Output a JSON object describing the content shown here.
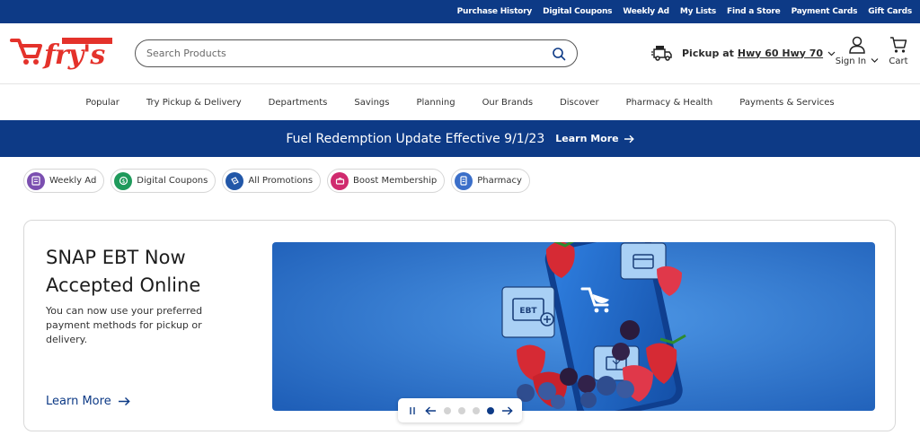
{
  "utility_links": [
    "Purchase History",
    "Digital Coupons",
    "Weekly Ad",
    "My Lists",
    "Find a Store",
    "Payment Cards",
    "Gift Cards"
  ],
  "header": {
    "search_placeholder": "Search Products",
    "pickup_label": "Pickup at",
    "store_name": "Hwy 60 Hwy 70",
    "signin_label": "Sign In",
    "cart_label": "Cart"
  },
  "nav": [
    "Popular",
    "Try Pickup & Delivery",
    "Departments",
    "Savings",
    "Planning",
    "Our Brands",
    "Discover",
    "Pharmacy & Health",
    "Payments & Services"
  ],
  "banner": {
    "message": "Fuel Redemption Update Effective 9/1/23",
    "link": "Learn More"
  },
  "chips": [
    {
      "label": "Weekly Ad",
      "color": "#7b4fb0"
    },
    {
      "label": "Digital Coupons",
      "color": "#1f9a5b"
    },
    {
      "label": "All Promotions",
      "color": "#2257a8"
    },
    {
      "label": "Boost Membership",
      "color": "#d02a6e"
    },
    {
      "label": "Pharmacy",
      "color": "#3b6fc9"
    }
  ],
  "hero": {
    "title": "SNAP EBT Now Accepted Online",
    "body": "You can now use your preferred payment methods for pickup or delivery.",
    "link": "Learn More",
    "ebt_card_text": "EBT"
  },
  "carousel": {
    "slide_count": 5,
    "active_index": 4
  },
  "colors": {
    "brand_blue": "#0d3a86",
    "brand_red": "#e4322b",
    "hero_blue": "#2b74cf"
  }
}
